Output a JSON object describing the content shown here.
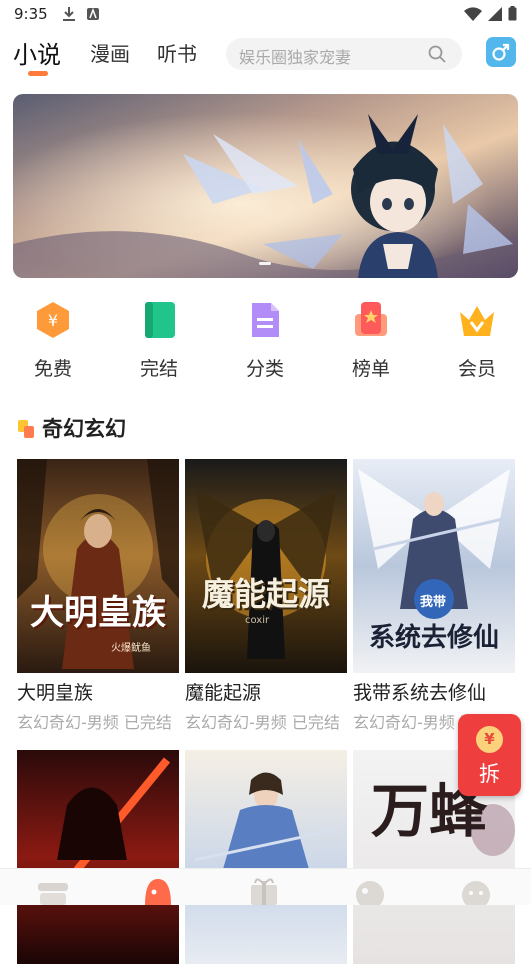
{
  "status": {
    "time": "9:35"
  },
  "tabs": [
    {
      "label": "小说",
      "active": true
    },
    {
      "label": "漫画",
      "active": false
    },
    {
      "label": "听书",
      "active": false
    }
  ],
  "search": {
    "placeholder": "娱乐圈独家宠妻"
  },
  "gender_icon": "male-icon",
  "categories": [
    {
      "label": "免费",
      "icon": "coin-hexagon-icon"
    },
    {
      "label": "完结",
      "icon": "green-book-icon"
    },
    {
      "label": "分类",
      "icon": "document-icon"
    },
    {
      "label": "榜单",
      "icon": "ranking-icon"
    },
    {
      "label": "会员",
      "icon": "crown-icon"
    }
  ],
  "section": {
    "title": "奇幻玄幻"
  },
  "books": [
    {
      "title": "大明皇族",
      "meta": "玄幻奇幻-男频 已完结",
      "cover_text": "大明皇族",
      "cover_caption": "火爆鱿鱼"
    },
    {
      "title": "魔能起源",
      "meta": "玄幻奇幻-男频 已完结",
      "cover_text": "魔能起源",
      "cover_caption": "coxir"
    },
    {
      "title": "我带系统去修仙",
      "meta": "玄幻奇幻-男频 已完结",
      "cover_text": "系统去修仙",
      "cover_caption": "我带"
    },
    {
      "title": "",
      "meta": "",
      "cover_text": "",
      "cover_caption": ""
    },
    {
      "title": "",
      "meta": "",
      "cover_text": "",
      "cover_caption": ""
    },
    {
      "title": "",
      "meta": "",
      "cover_text": "万蜂",
      "cover_caption": ""
    }
  ],
  "redpacket": {
    "label": "拆",
    "coin": "¥"
  },
  "colors": {
    "accent": "#ff7a3d",
    "redpacket": "#ef3e3e",
    "gender": "#53b6ec"
  }
}
